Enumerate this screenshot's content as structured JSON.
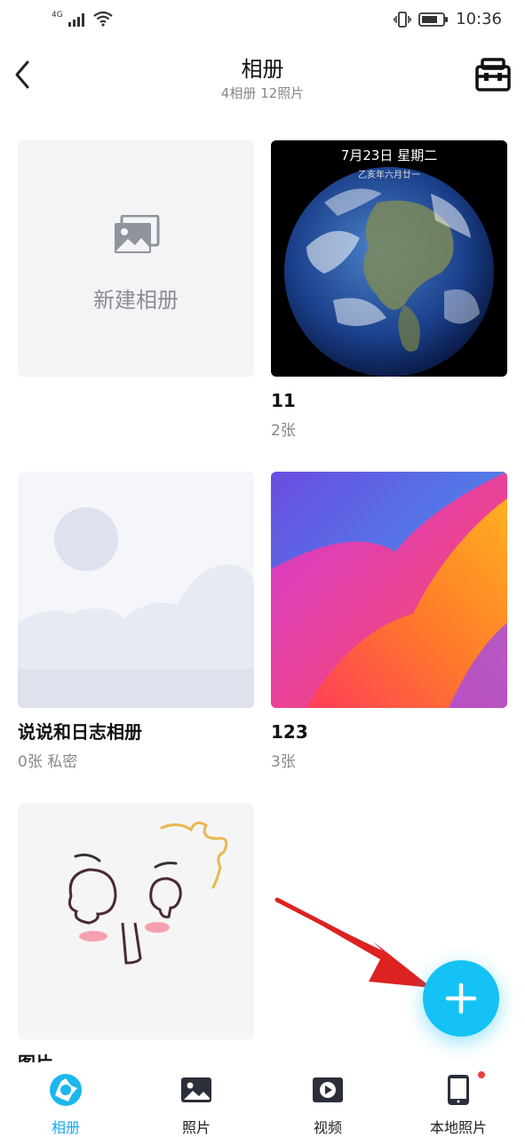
{
  "status_bar": {
    "network": "4G",
    "time": "10:36"
  },
  "header": {
    "title": "相册",
    "subtitle": "4相册  12照片"
  },
  "new_album": {
    "label": "新建相册"
  },
  "albums": [
    {
      "name": "11",
      "meta": "2张",
      "cover_text": {
        "date": "7月23日 星期二",
        "lunar": "乙亥年六月廿一"
      }
    },
    {
      "name": "说说和日志相册",
      "meta": "0张  私密"
    },
    {
      "name": "123",
      "meta": "3张"
    },
    {
      "name": "图片",
      "meta": ""
    }
  ],
  "tabs": [
    {
      "label": "相册",
      "icon": "album-shutter-icon",
      "active": true
    },
    {
      "label": "照片",
      "icon": "photo-icon",
      "active": false
    },
    {
      "label": "视频",
      "icon": "video-play-icon",
      "active": false
    },
    {
      "label": "本地照片",
      "icon": "phone-icon",
      "active": false,
      "badge": true
    }
  ],
  "colors": {
    "accent": "#15c2f5",
    "active_tab": "#14a9e8",
    "arrow": "#dd2222",
    "badge": "#ee4040"
  }
}
